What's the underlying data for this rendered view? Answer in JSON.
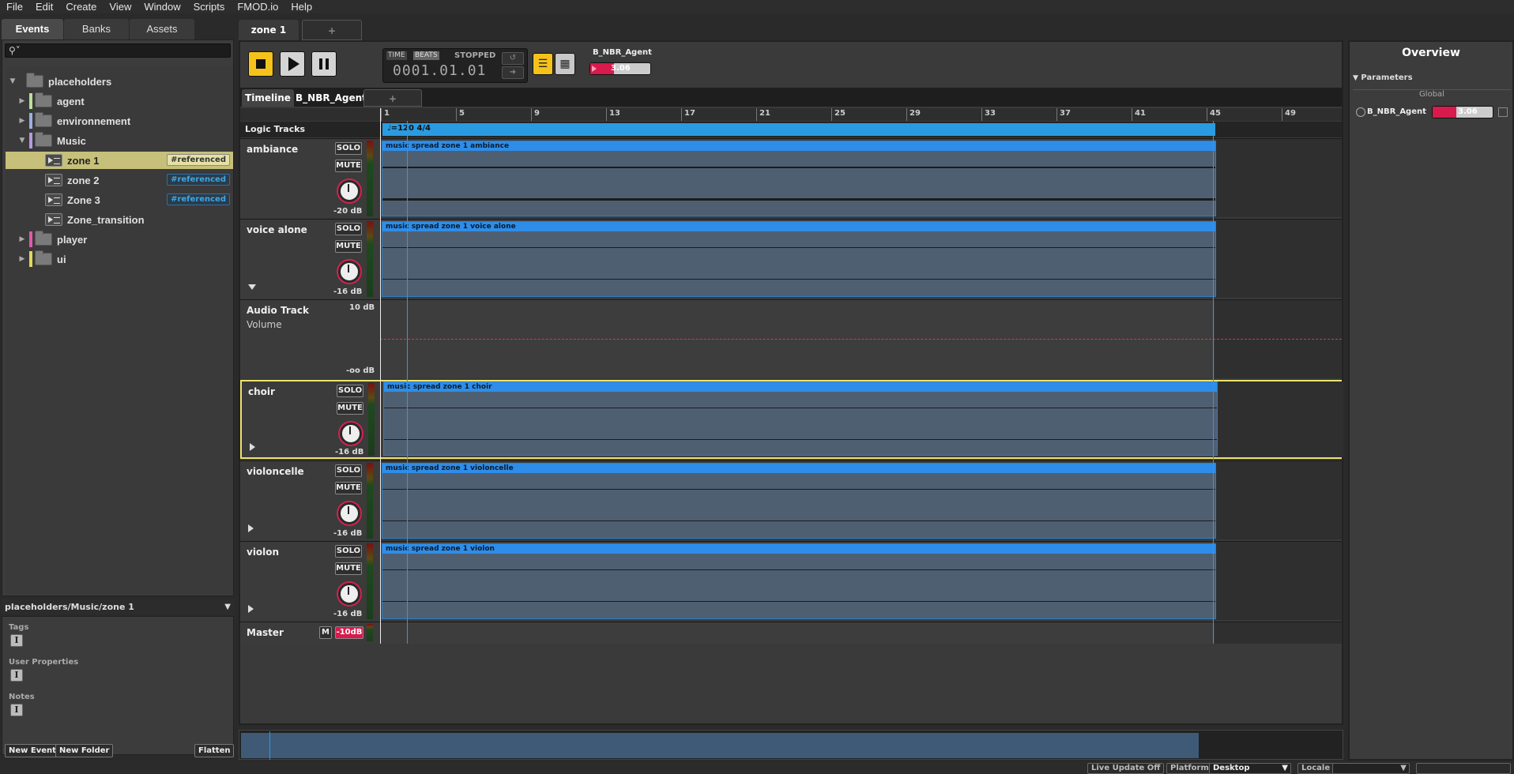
{
  "menu": [
    "File",
    "Edit",
    "Create",
    "View",
    "Window",
    "Scripts",
    "FMOD.io",
    "Help"
  ],
  "browser": {
    "tabs": [
      "Events",
      "Banks",
      "Assets"
    ],
    "search_placeholder": "",
    "tree": [
      {
        "label": "placeholders",
        "type": "folder",
        "depth": 0,
        "expanded": true,
        "color": ""
      },
      {
        "label": "agent",
        "type": "folder",
        "depth": 1,
        "expanded": false,
        "color": "#b8e39a"
      },
      {
        "label": "environnement",
        "type": "folder",
        "depth": 1,
        "expanded": false,
        "color": "#9ab0e0"
      },
      {
        "label": "Music",
        "type": "folder",
        "depth": 1,
        "expanded": true,
        "color": "#b49ae0"
      },
      {
        "label": "zone 1",
        "type": "event",
        "depth": 2,
        "badge": "#referenced",
        "selected": true
      },
      {
        "label": "zone 2",
        "type": "event",
        "depth": 2,
        "badge": "#referenced"
      },
      {
        "label": "Zone 3",
        "type": "event",
        "depth": 2,
        "badge": "#referenced"
      },
      {
        "label": "Zone_transition",
        "type": "event",
        "depth": 2,
        "badge": ""
      },
      {
        "label": "player",
        "type": "folder",
        "depth": 1,
        "expanded": false,
        "color": "#e05aa8"
      },
      {
        "label": "ui",
        "type": "folder",
        "depth": 1,
        "expanded": false,
        "color": "#e0d85a"
      }
    ],
    "path": "placeholders/Music/zone 1",
    "details": {
      "tags": "Tags",
      "user_properties": "User Properties",
      "notes": "Notes"
    },
    "buttons": {
      "new_event": "New Event",
      "new_folder": "New Folder",
      "flatten": "Flatten"
    }
  },
  "editor": {
    "tabs": [
      "zone 1",
      "+"
    ],
    "transport": {
      "time_mode": "TIME",
      "beats_mode": "BEATS",
      "state": "STOPPED",
      "position": "0001.01.01",
      "param_name": "B_NBR_Agent",
      "param_value": "3.06",
      "param_fraction": 0.4
    },
    "sub_tabs": [
      "Timeline",
      "B_NBR_Agent",
      "+"
    ],
    "ruler": [
      "1",
      "5",
      "9",
      "13",
      "17",
      "21",
      "25",
      "29",
      "33",
      "37",
      "41",
      "45",
      "49"
    ],
    "logic_tracks_label": "Logic Tracks",
    "tempo": "♩=120 4/4",
    "tracks": [
      {
        "name": "ambiance",
        "db": "-20 dB",
        "region": "music spread zone 1 ambiance",
        "solo": "SOLO",
        "mute": "MUTE"
      },
      {
        "name": "voice alone",
        "db": "-16 dB",
        "region": "music spread zone 1 voice alone",
        "solo": "SOLO",
        "mute": "MUTE"
      },
      {
        "name": "choir",
        "db": "-16 dB",
        "region": "music spread zone 1 choir",
        "solo": "SOLO",
        "mute": "MUTE"
      },
      {
        "name": "violoncelle",
        "db": "-16 dB",
        "region": "music spread zone 1 violoncelle",
        "solo": "SOLO",
        "mute": "MUTE"
      },
      {
        "name": "violon",
        "db": "-16 dB",
        "region": "music spread zone 1 violon",
        "solo": "SOLO",
        "mute": "MUTE"
      }
    ],
    "automation": {
      "name": "Audio Track",
      "property": "Volume",
      "top": "10 dB",
      "bottom": "-oo dB"
    },
    "master": {
      "name": "Master",
      "m": "M",
      "db": "-10dB"
    }
  },
  "overview": {
    "title": "Overview",
    "parameters": "Parameters",
    "global": "Global",
    "param_name": "B_NBR_Agent",
    "param_value": "3.06"
  },
  "status": {
    "live_update": "Live Update Off",
    "platform_label": "Platform",
    "platform_value": "Desktop",
    "locale_label": "Locale"
  }
}
